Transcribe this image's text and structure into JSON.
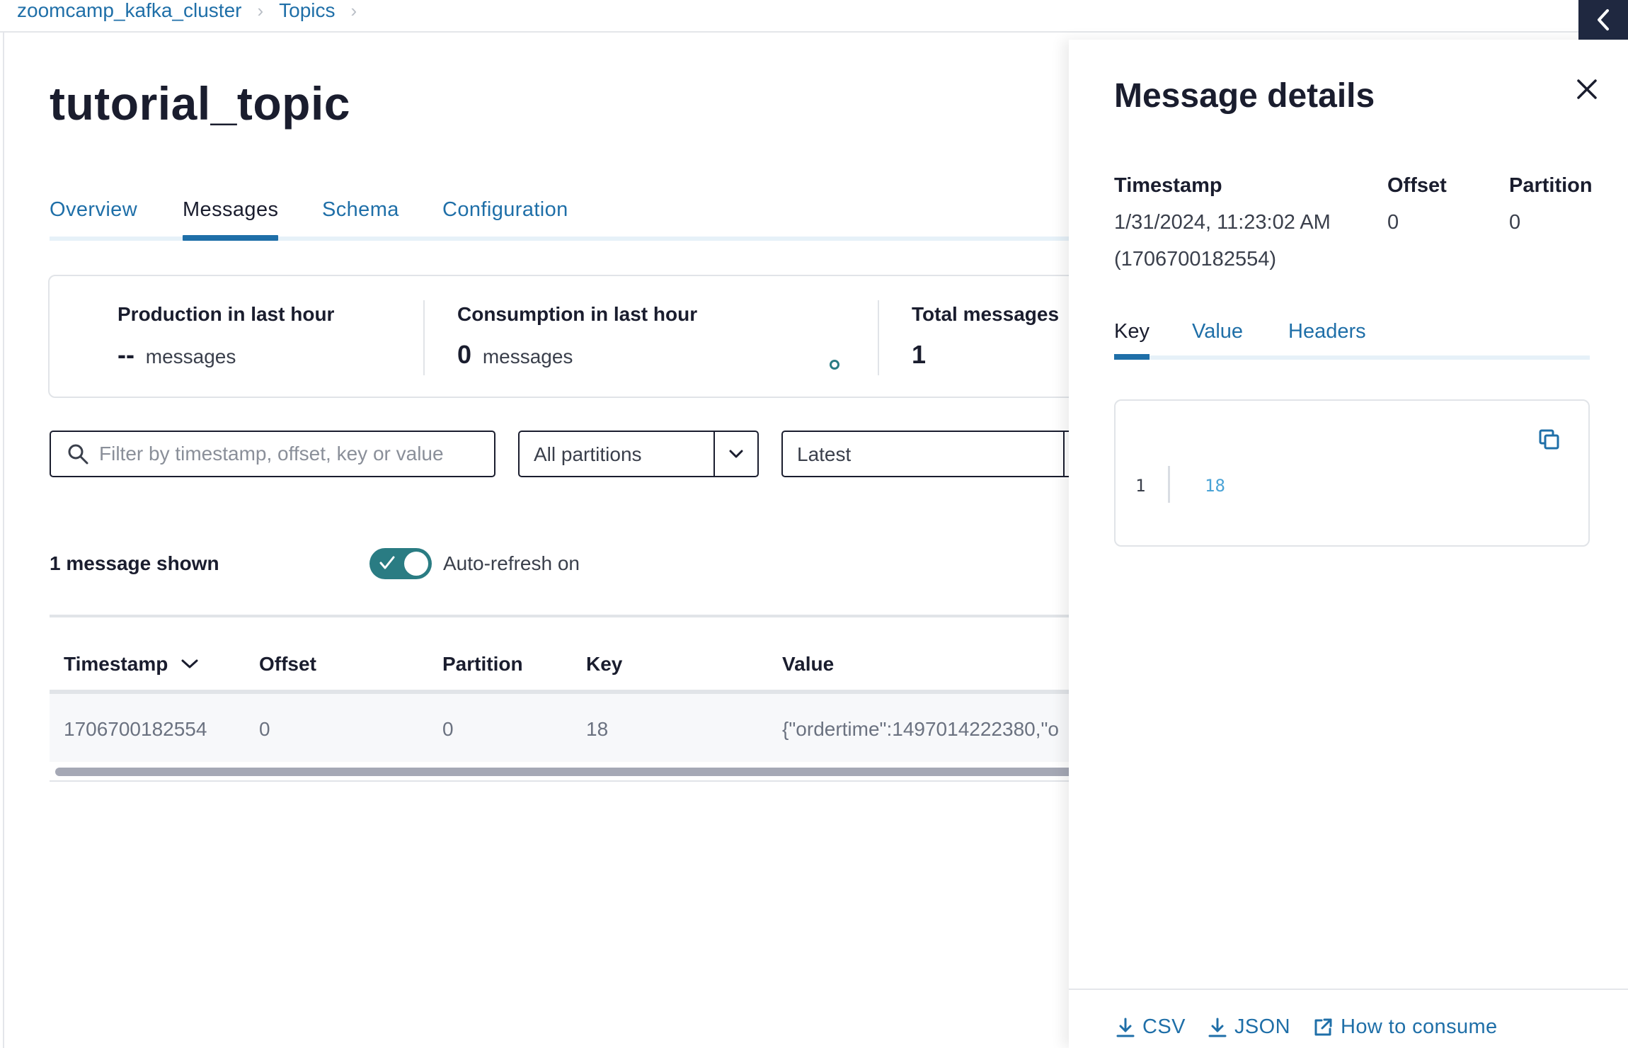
{
  "breadcrumb": {
    "cluster": "zoomcamp_kafka_cluster",
    "topics": "Topics"
  },
  "page": {
    "title": "tutorial_topic"
  },
  "tabs": [
    "Overview",
    "Messages",
    "Schema",
    "Configuration"
  ],
  "active_tab": "Messages",
  "stats": {
    "production": {
      "label": "Production in last hour",
      "value": "--",
      "unit": "messages"
    },
    "consumption": {
      "label": "Consumption in last hour",
      "value": "0",
      "unit": "messages"
    },
    "total": {
      "label": "Total messages",
      "value": "1"
    }
  },
  "filters": {
    "search_placeholder": "Filter by timestamp, offset, key or value",
    "partitions": "All partitions",
    "offset_mode": "Latest"
  },
  "messages": {
    "shown": "1 message shown",
    "auto_refresh": "Auto-refresh on",
    "auto_refresh_enabled": true
  },
  "table": {
    "columns": [
      "Timestamp",
      "Offset",
      "Partition",
      "Key",
      "Value"
    ],
    "rows": [
      {
        "timestamp": "1706700182554",
        "offset": "0",
        "partition": "0",
        "key": "18",
        "value": "{\"ordertime\":1497014222380,\"o"
      }
    ]
  },
  "drawer": {
    "title": "Message details",
    "timestamp_label": "Timestamp",
    "timestamp_value": "1/31/2024, 11:23:02 AM",
    "timestamp_epoch": "(1706700182554)",
    "offset_label": "Offset",
    "offset_value": "0",
    "partition_label": "Partition",
    "partition_value": "0",
    "tabs": [
      "Key",
      "Value",
      "Headers"
    ],
    "active_tab": "Key",
    "code": {
      "line": "1",
      "content": "18"
    },
    "footer": {
      "csv": "CSV",
      "json": "JSON",
      "consume": "How to consume"
    }
  },
  "colors": {
    "accent": "#1f6fa8",
    "toggle": "#2a7c83",
    "nav_dark": "#1f2840"
  }
}
